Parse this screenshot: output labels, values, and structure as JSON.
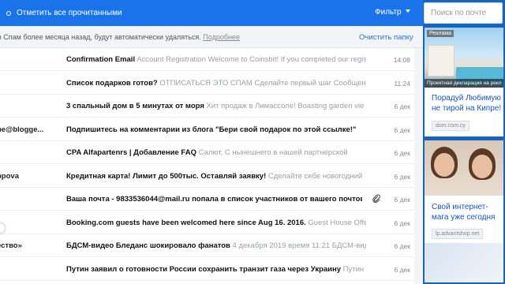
{
  "toolbar": {
    "mark_all_read": "Отметить все прочитанными",
    "filter": "Фильтр"
  },
  "search": {
    "placeholder": "Поиск по почте"
  },
  "notice": {
    "text": "в Спам более месяца назад, будут автоматически удаляться.",
    "more_link": "Подробнее",
    "clean_folder": "Очистить папку"
  },
  "messages": [
    {
      "sender": "",
      "subject": "Confirmation Email",
      "snippet": "Account Registration Welcome to Coinsbit! If you completed our regis",
      "date": "14:08",
      "attachment": false
    },
    {
      "sender": "",
      "subject": "Список подарков готов?",
      "snippet": "ОТПИСАТЬСЯ ЭТО СПАМ Сделайте первый шаг Сообщен",
      "date": "11:24",
      "attachment": false
    },
    {
      "sender": "",
      "subject": "3 спальный дом в 5 минутах от моря",
      "snippet": "Хит продаж в Лимассоле! Boasting garden vie",
      "date": "6 дек",
      "attachment": false
    },
    {
      "sender": "be@blogge...",
      "subject": "Подпишитесь на комментарии из блога \"Бери свой подарок по этой ссылке!\"",
      "snippet": "",
      "date": "6 дек",
      "attachment": false
    },
    {
      "sender": "",
      "subject": "CPA Alfapartenrs | Добавление FAQ",
      "snippet": "Салют, С нынешнего в нашей партнерской",
      "date": "6 дек",
      "attachment": false
    },
    {
      "sender": "ppova",
      "subject": "Кредитная карта! Лимит до 500тыс. Оставляй заявку!",
      "snippet": "Сделайте себе новогодний",
      "date": "6 дек",
      "attachment": false
    },
    {
      "sender": "",
      "subject": "Ваша почта - 9833536044@mail.ru попала в список участников от вашего почтов",
      "snippet": "",
      "date": "6 дек",
      "attachment": true
    },
    {
      "sender": "",
      "subject": "Booking.com guests have been welcomed here since Aug 16. 2016.",
      "snippet": "Guest House Offe",
      "date": "6 дек",
      "attachment": false
    },
    {
      "sender": "ество»",
      "subject": "БДСМ-видео Бледанс шокировало фанатов",
      "snippet": "4 декабря 2019 время 11:21 БДСМ-видео",
      "date": "6 дек",
      "attachment": false
    },
    {
      "sender": "",
      "subject": "Путин заявил о готовности России сохранить транзит газа через Украину",
      "snippet": "Путин за",
      "date": "6 дек",
      "attachment": false
    }
  ],
  "ads": [
    {
      "badge": "Реклама",
      "caption": "Проектная декларация на рекл",
      "title": "Порадуй Любимую не тирой на Кипре!",
      "domain": "dom.com.cy"
    },
    {
      "title": "Свой интернет-мага уже сегодня",
      "domain": "lp.advantshop.net"
    }
  ]
}
